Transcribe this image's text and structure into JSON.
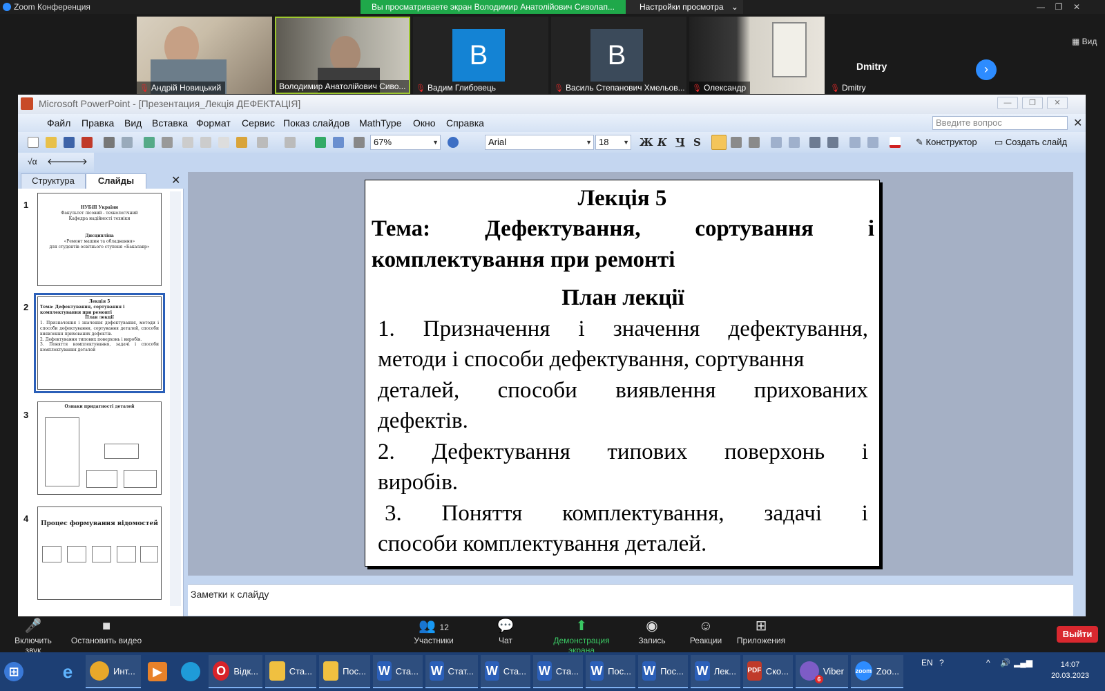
{
  "zoom_top": {
    "app_title": "Zoom Конференция",
    "share_banner": "Вы просматриваете экран Володимир Анатолійович Сиволап...",
    "view_options": "Настройки просмотра",
    "view_label": "Вид"
  },
  "participants": [
    {
      "name": "Андрій Новицький"
    },
    {
      "name": "Володимир Анатолійович Сиво..."
    },
    {
      "name": "Вадим Глибовець",
      "initial": "B"
    },
    {
      "name": "Василь Степанович Хмельов...",
      "initial": "B"
    },
    {
      "name": "Олександр"
    },
    {
      "name": "Dmitry",
      "display_name": "Dmitry"
    }
  ],
  "ppt": {
    "window_title": "Microsoft PowerPoint - [Презентация_Лекція ДЕФЕКТАЦІЯ]",
    "menu": [
      "Файл",
      "Правка",
      "Вид",
      "Вставка",
      "Формат",
      "Сервис",
      "Показ слайдов",
      "MathType",
      "Окно",
      "Справка"
    ],
    "ask_placeholder": "Введите вопрос",
    "zoom_value": "67%",
    "font_name": "Arial",
    "font_size": "18",
    "bold": "Ж",
    "italic": "К",
    "underline": "Ч",
    "shadow": "S",
    "designer_label": "Конструктор",
    "new_slide_label": "Создать слайд",
    "tabs": {
      "outline": "Структура",
      "slides": "Слайды"
    },
    "notes_placeholder": "Заметки к слайду"
  },
  "thumbnails": [
    {
      "num": "1",
      "lines": [
        "НУБіП України",
        "Факультет лісовий - технологічний",
        "Кафедра надійності техніки",
        "Дисципліна",
        "«Ремонт машин та обладнання»",
        "для студентів освітнього ступеня «Бакалавр»"
      ]
    },
    {
      "num": "2",
      "lines": [
        "Лекція 5",
        "Тема: Дефектування, сортування і комплектування при ремонті",
        "План лекції",
        "1. Призначення і значення дефектування, методи і способи дефектування, сортування деталей, способи виявлення прихованих дефектів.",
        "2. Дефектування типових поверхонь і виробів.",
        "3. Поняття комплектування, задачі і способи комплектування деталей"
      ]
    },
    {
      "num": "3",
      "lines": [
        "Ознаки придатності деталей"
      ]
    },
    {
      "num": "4",
      "lines": [
        "Процес формування відомостей"
      ]
    }
  ],
  "slide": {
    "heading": "Лекція 5",
    "topic_line1": [
      "Тема:",
      "Дефектування,",
      "сортування",
      "і"
    ],
    "topic_line2": "комплектування при ремонті",
    "plan_title": "План лекції",
    "line1": [
      "1.",
      "Призначення",
      "і",
      "значення",
      "дефектування,"
    ],
    "line2": "методи і способи дефектування, сортування",
    "line3": [
      "деталей,",
      "способи",
      "виявлення",
      "прихованих"
    ],
    "line4": "дефектів.",
    "line5": [
      "2.",
      "Дефектування",
      "типових",
      "поверхонь",
      "і"
    ],
    "line6": "виробів.",
    "line7": [
      "3.",
      "Поняття",
      "комплектування,",
      "задачі",
      "і"
    ],
    "line8": "способи комплектування деталей."
  },
  "zoom_controls": {
    "mute": "Включить звук",
    "video": "Остановить видео",
    "participants": "Участники",
    "participants_count": "12",
    "chat": "Чат",
    "share": "Демонстрация экрана",
    "record": "Запись",
    "reactions": "Реакции",
    "apps": "Приложения",
    "leave": "Выйти"
  },
  "taskbar": {
    "items": [
      "Инт...",
      "Відк...",
      "Ста...",
      "Пос...",
      "Ста...",
      "Стат...",
      "Ста...",
      "Ста...",
      "Пос...",
      "Пос...",
      "Лек...",
      "Ско...",
      "Viber",
      "Zoo..."
    ],
    "viber_badge": "6",
    "lang": "EN",
    "time": "14:07",
    "date": "20.03.2023"
  },
  "colors": {
    "share_banner": "#1fa84a",
    "leave_button": "#d9282f",
    "zoom_blue": "#2d8cff",
    "ppt_frame": "#c4d6f0",
    "slide_area": "#a5b0c5",
    "taskbar": "#1d3f74"
  }
}
